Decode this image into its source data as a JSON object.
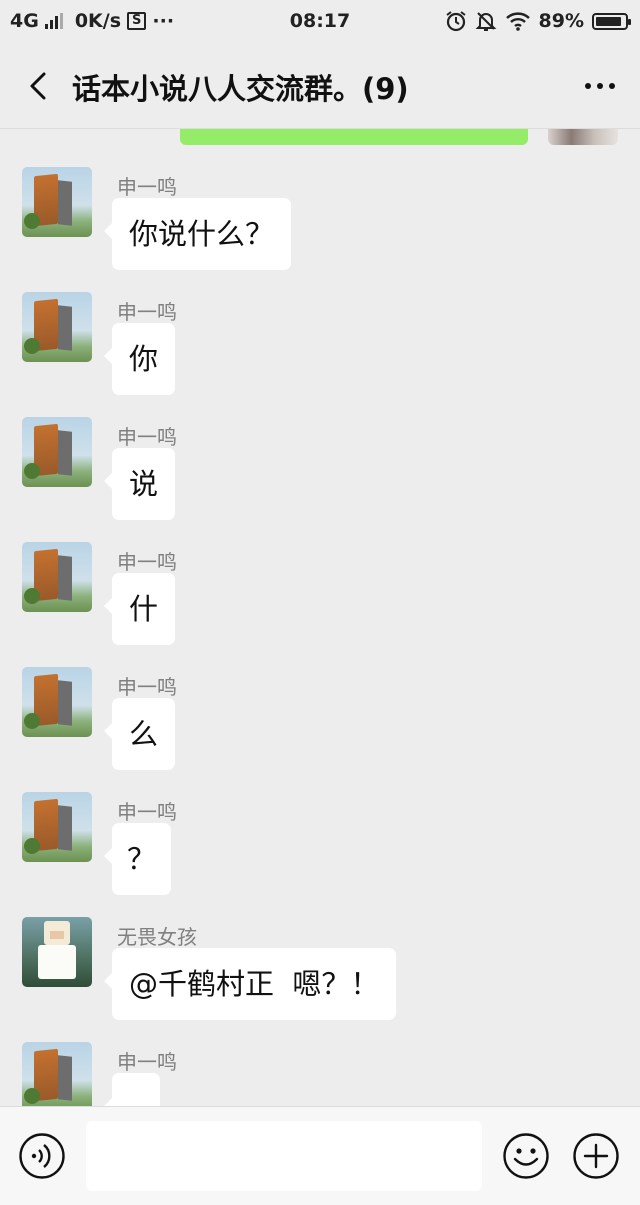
{
  "status_bar": {
    "network": "4G",
    "speed": "0K/s",
    "extra_icon": "S",
    "dots": "···",
    "time": "08:17",
    "battery": "89%",
    "battery_level": 0.89,
    "icons": [
      "alarm-icon",
      "bell-off-icon",
      "wifi-icon",
      "battery-icon"
    ]
  },
  "header": {
    "title": "话本小说八人交流群。(9)",
    "back_icon": "chevron-left-icon",
    "more_icon": "more-dots-icon"
  },
  "messages": [
    {
      "sender": "申一鸣",
      "avatar": "tower-avatar",
      "text": "你说什么？"
    },
    {
      "sender": "申一鸣",
      "avatar": "tower-avatar",
      "text": "你"
    },
    {
      "sender": "申一鸣",
      "avatar": "tower-avatar",
      "text": "说"
    },
    {
      "sender": "申一鸣",
      "avatar": "tower-avatar",
      "text": "什"
    },
    {
      "sender": "申一鸣",
      "avatar": "tower-avatar",
      "text": "么"
    },
    {
      "sender": "申一鸣",
      "avatar": "tower-avatar",
      "text": "？"
    },
    {
      "sender": "无畏女孩",
      "avatar": "girl-avatar",
      "text": "@千鹤村正  嗯？！"
    },
    {
      "sender": "申一鸣",
      "avatar": "tower-avatar",
      "text": ""
    }
  ],
  "input_bar": {
    "voice_icon": "voice-icon",
    "input_value": "",
    "emoji_icon": "emoji-icon",
    "plus_icon": "plus-icon"
  },
  "colors": {
    "background": "#ededed",
    "bubble_incoming": "#ffffff",
    "bubble_outgoing": "#95ec69",
    "sender_name": "#808080"
  }
}
